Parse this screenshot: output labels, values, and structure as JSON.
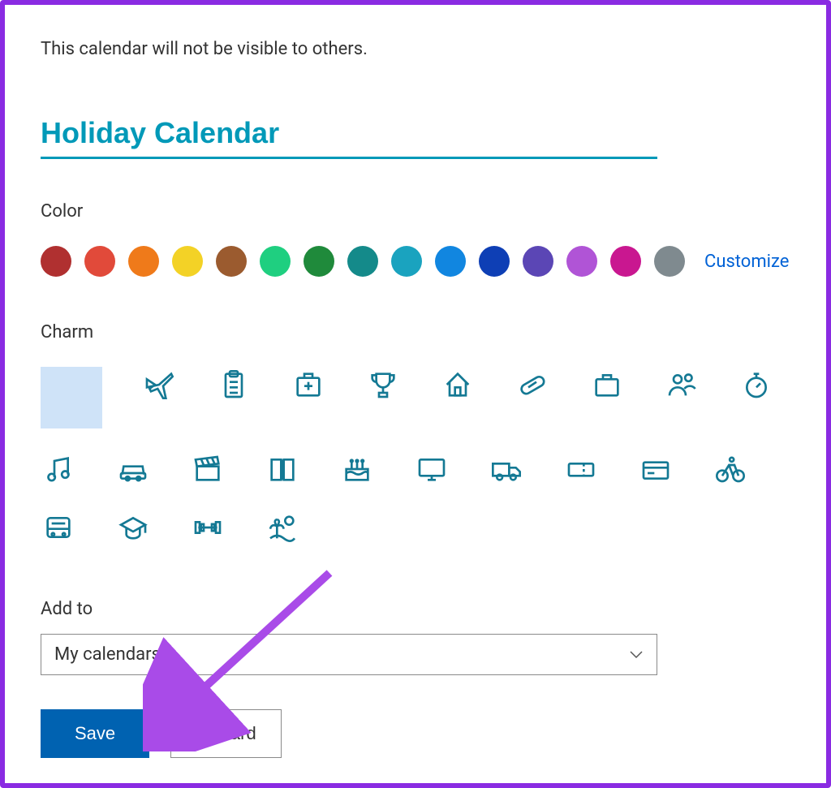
{
  "info_text": "This calendar will not be visible to others.",
  "calendar_name": "Holiday Calendar",
  "color_section": {
    "label": "Color",
    "customize": "Customize",
    "swatches": [
      "#b03030",
      "#e14a3a",
      "#ef7a1a",
      "#f3d226",
      "#9b5b2f",
      "#1fcf80",
      "#1f8a3b",
      "#148a8a",
      "#1aa3bf",
      "#1186e0",
      "#0e3fb5",
      "#5b46b5",
      "#b054d6",
      "#c91790",
      "#7f8a8f"
    ]
  },
  "charm_section": {
    "label": "Charm",
    "charms": [
      "none",
      "airplane",
      "clipboard",
      "first-aid",
      "trophy",
      "home",
      "pill",
      "briefcase",
      "people",
      "stopwatch",
      "music",
      "car",
      "clapper",
      "book",
      "cake",
      "monitor",
      "truck",
      "ticket",
      "credit-card",
      "bicycle",
      "bus",
      "graduation",
      "dumbbell",
      "vacation"
    ]
  },
  "addto": {
    "label": "Add to",
    "selected": "My calendars"
  },
  "buttons": {
    "save": "Save",
    "discard": "Discard"
  }
}
